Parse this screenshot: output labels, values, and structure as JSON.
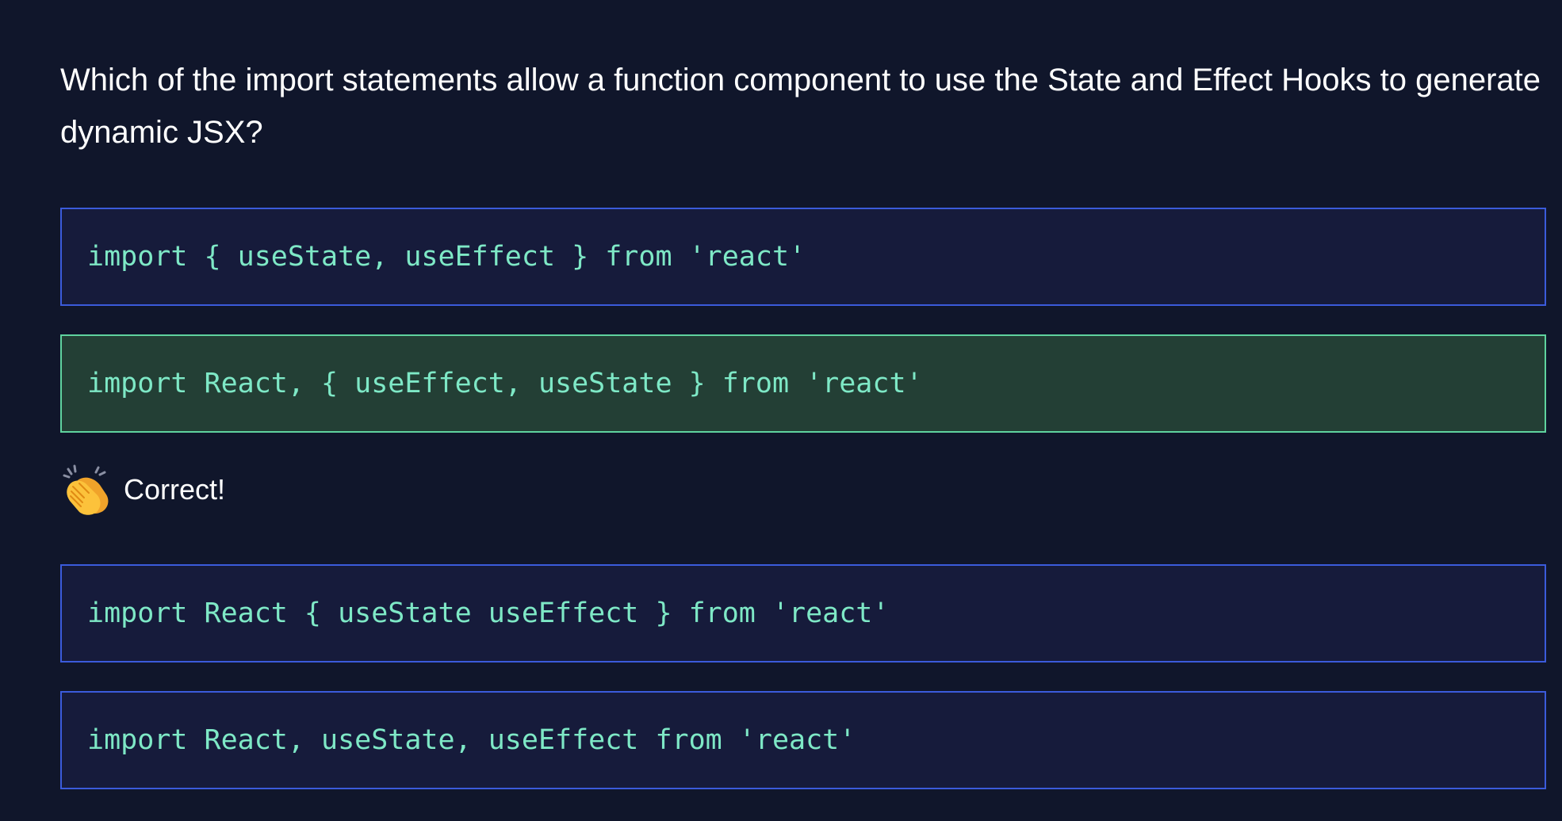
{
  "question": {
    "text": "Which of the import statements allow a function component to use the State and Effect Hooks to generate dynamic JSX?"
  },
  "options": [
    {
      "code": "import { useState, useEffect } from 'react'",
      "state": "default"
    },
    {
      "code": "import React, { useEffect, useState } from 'react'",
      "state": "correct"
    },
    {
      "code": "import React { useState useEffect } from 'react'",
      "state": "default"
    },
    {
      "code": "import React, useState, useEffect from 'react'",
      "state": "default"
    }
  ],
  "feedback": {
    "icon": "clapping-hands-icon",
    "text": "Correct!"
  },
  "colors": {
    "background": "#10162b",
    "option_bg": "#161b3b",
    "option_border": "#3b5bdb",
    "correct_bg": "#233f35",
    "correct_border": "#5fd39f",
    "code_text": "#7ee8c6"
  }
}
